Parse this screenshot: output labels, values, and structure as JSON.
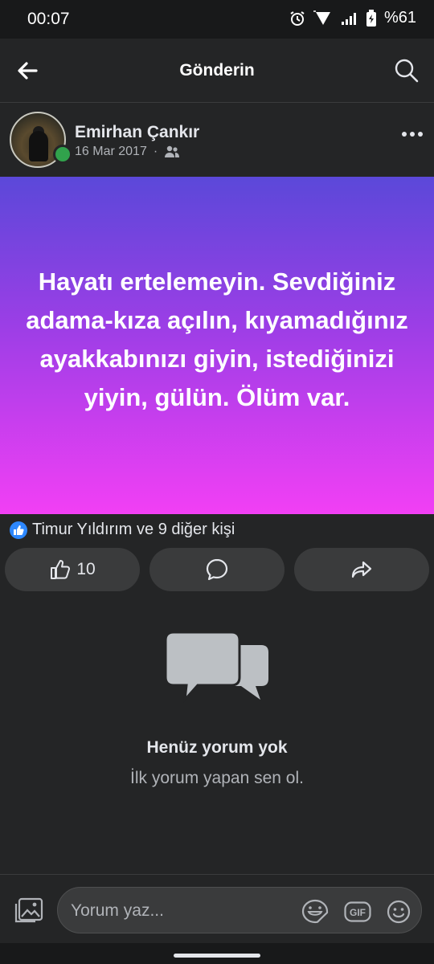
{
  "status_bar": {
    "time": "00:07",
    "battery": "%61"
  },
  "top_bar": {
    "title": "Gönderin"
  },
  "post": {
    "author": "Emirhan Çankır",
    "date": "16 Mar 2017",
    "text": "Hayatı ertelemeyin. Sevdiğiniz adama-kıza açılın, kıyamadığınız ayakkabınızı giyin, istediğinizi yiyin, gülün. Ölüm var.",
    "reactions_text": "Timur Yıldırım ve 9 diğer kişi",
    "like_count": "10"
  },
  "comments_empty": {
    "heading": "Henüz yorum yok",
    "subtext": "İlk yorum yapan sen ol."
  },
  "composer": {
    "placeholder": "Yorum yaz..."
  },
  "colors": {
    "background": "#242526",
    "accent": "#2d88ff",
    "online": "#31a24c",
    "gradient_top": "#5b48d9",
    "gradient_bottom": "#f23ff5"
  }
}
